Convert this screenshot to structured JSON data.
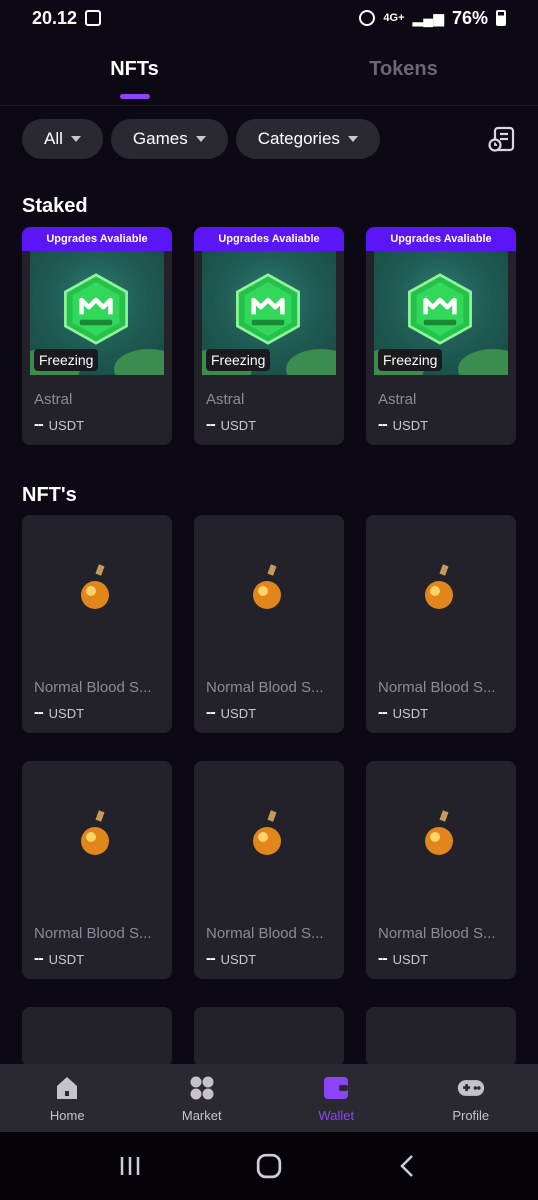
{
  "status_bar": {
    "time": "20.12",
    "battery": "76%",
    "network": "4G+"
  },
  "tabs": [
    {
      "label": "NFTs",
      "active": true
    },
    {
      "label": "Tokens",
      "active": false
    }
  ],
  "filters": [
    {
      "label": "All"
    },
    {
      "label": "Games"
    },
    {
      "label": "Categories"
    }
  ],
  "staked": {
    "title": "Staked",
    "cards": [
      {
        "ribbon": "Upgrades Avaliable",
        "status": "Freezing",
        "name": "Astral",
        "price": "--",
        "currency": "USDT"
      },
      {
        "ribbon": "Upgrades Avaliable",
        "status": "Freezing",
        "name": "Astral",
        "price": "--",
        "currency": "USDT"
      },
      {
        "ribbon": "Upgrades Avaliable",
        "status": "Freezing",
        "name": "Astral",
        "price": "--",
        "currency": "USDT"
      }
    ]
  },
  "nfts": {
    "title": "NFT's",
    "rows": [
      [
        {
          "name": "Normal Blood S...",
          "price": "--",
          "currency": "USDT"
        },
        {
          "name": "Normal Blood S...",
          "price": "--",
          "currency": "USDT"
        },
        {
          "name": "Normal Blood S...",
          "price": "--",
          "currency": "USDT"
        }
      ],
      [
        {
          "name": "Normal Blood S...",
          "price": "--",
          "currency": "USDT"
        },
        {
          "name": "Normal Blood S...",
          "price": "--",
          "currency": "USDT"
        },
        {
          "name": "Normal Blood S...",
          "price": "--",
          "currency": "USDT"
        }
      ]
    ]
  },
  "bottom_nav": [
    {
      "label": "Home",
      "icon": "home-icon",
      "active": false
    },
    {
      "label": "Market",
      "icon": "market-icon",
      "active": false
    },
    {
      "label": "Wallet",
      "icon": "wallet-icon",
      "active": true
    },
    {
      "label": "Profile",
      "icon": "gamepad-icon",
      "active": false
    }
  ],
  "colors": {
    "accent": "#8b44f6",
    "ribbon": "#5a16f5",
    "background": "#0c0814",
    "card": "#23222a"
  }
}
